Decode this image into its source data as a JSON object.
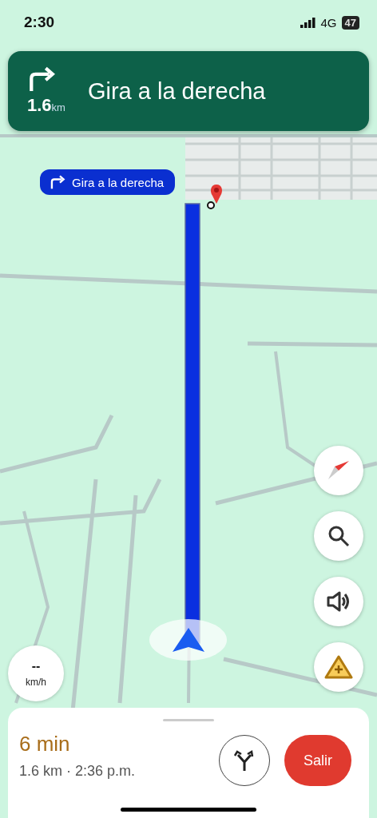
{
  "status_bar": {
    "time": "2:30",
    "network": "4G",
    "battery": "47"
  },
  "instruction": {
    "distance": "1.6",
    "unit": "km",
    "text": "Gira a la derecha"
  },
  "callout": {
    "text": "Gira a la derecha"
  },
  "speed": {
    "value": "--",
    "unit": "km/h"
  },
  "trip": {
    "duration": "6 min",
    "details": "1.6 km · 2:36 p.m.",
    "exit_button": "Salir"
  }
}
